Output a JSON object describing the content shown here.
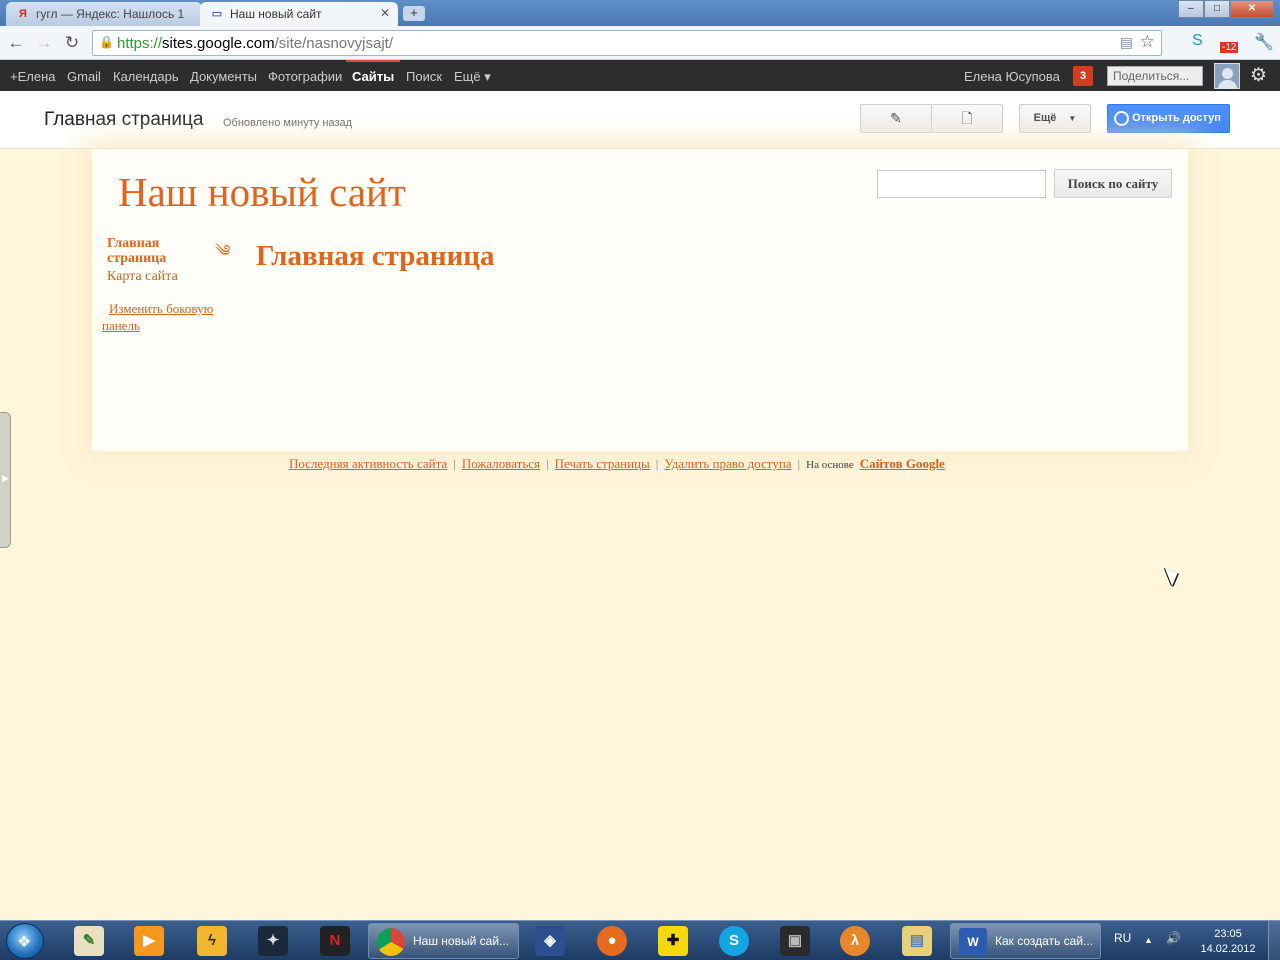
{
  "browser": {
    "tabs": [
      {
        "title": "гугл — Яндекс: Нашлось 1",
        "favicon": "Я",
        "active": false
      },
      {
        "title": "Наш новый сайт",
        "favicon": "▭",
        "active": true
      }
    ],
    "new_tab_label": "+",
    "url": {
      "scheme": "https://",
      "host": "sites.google.com",
      "path": "/site/nasnovyjsajt/"
    },
    "window_controls": {
      "minimize": "–",
      "maximize": "□",
      "close": "✕"
    },
    "extension_badge": "-12"
  },
  "gbar": {
    "items": [
      "+Елена",
      "Gmail",
      "Календарь",
      "Документы",
      "Фотографии",
      "Сайты",
      "Поиск",
      "Ещё ▾"
    ],
    "active_index": 5,
    "user_name": "Елена Юсупова",
    "notification_count": "3",
    "share_placeholder": "Поделиться..."
  },
  "sites_header": {
    "page_title": "Главная страница",
    "updated": "Обновлено минуту назад",
    "more_label": "Ещё",
    "share_label": "Открыть доступ"
  },
  "site": {
    "name": "Наш новый сайт",
    "search_button": "Поиск по сайту",
    "search_value": "",
    "nav": {
      "current": "Главная страница",
      "sitemap": "Карта сайта",
      "edit_sidebar": "Изменить боковую панель"
    },
    "content_title": "Главная страница"
  },
  "footer": {
    "links": [
      "Последняя активность сайта",
      "Пожаловаться",
      "Печать страницы",
      "Удалить право доступа"
    ],
    "based_on": "На основе",
    "google_sites": "Сайтов Google"
  },
  "taskbar": {
    "pinned_icons": [
      "notepad-icon",
      "media-player-icon",
      "winamp-icon",
      "counter-strike-icon",
      "game-icon"
    ],
    "chrome_button": "Наш новый сай...",
    "word_button": "Как создать сай...",
    "language": "RU",
    "time": "23:05",
    "date": "14.02.2012"
  },
  "colors": {
    "site_accent": "#e0641c",
    "site_background": "#fff6dc",
    "gbar_background": "#2d2d2d",
    "share_button": "#4d90fe",
    "notification": "#d23c22"
  }
}
